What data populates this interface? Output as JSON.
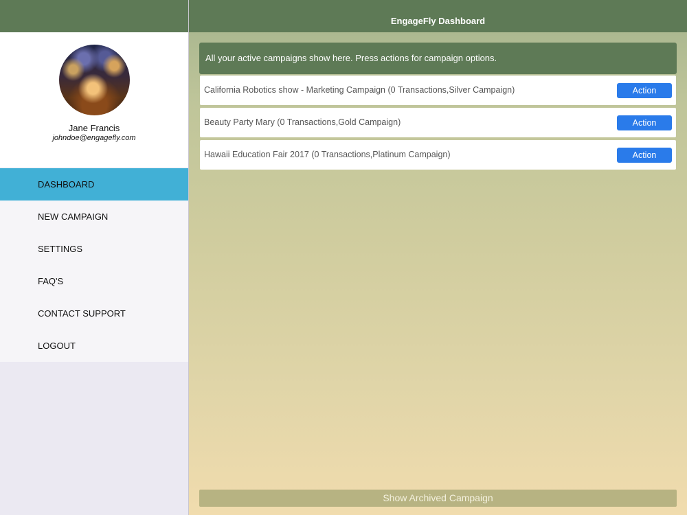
{
  "header": {
    "title": "EngageFly Dashboard"
  },
  "profile": {
    "name": "Jane Francis",
    "email": "johndoe@engagefly.com"
  },
  "sidebar": {
    "items": [
      {
        "label": "DASHBOARD",
        "active": true
      },
      {
        "label": "NEW CAMPAIGN",
        "active": false
      },
      {
        "label": "SETTINGS",
        "active": false
      },
      {
        "label": "FAQ'S",
        "active": false
      },
      {
        "label": "CONTACT SUPPORT",
        "active": false
      },
      {
        "label": "LOGOUT",
        "active": false
      }
    ]
  },
  "main": {
    "banner": "All your active campaigns show here. Press actions for campaign options.",
    "campaigns": [
      {
        "label": "California Robotics show - Marketing Campaign (0 Transactions,Silver Campaign)",
        "action": "Action"
      },
      {
        "label": "Beauty Party Mary (0 Transactions,Gold Campaign)",
        "action": "Action"
      },
      {
        "label": "Hawaii Education Fair 2017 (0 Transactions,Platinum Campaign)",
        "action": "Action"
      }
    ],
    "archived_button": "Show Archived Campaign"
  },
  "colors": {
    "header_green": "#5e7a56",
    "active_blue": "#41b0d6",
    "action_blue": "#2a7bea",
    "archived_olive": "#b7b382"
  }
}
